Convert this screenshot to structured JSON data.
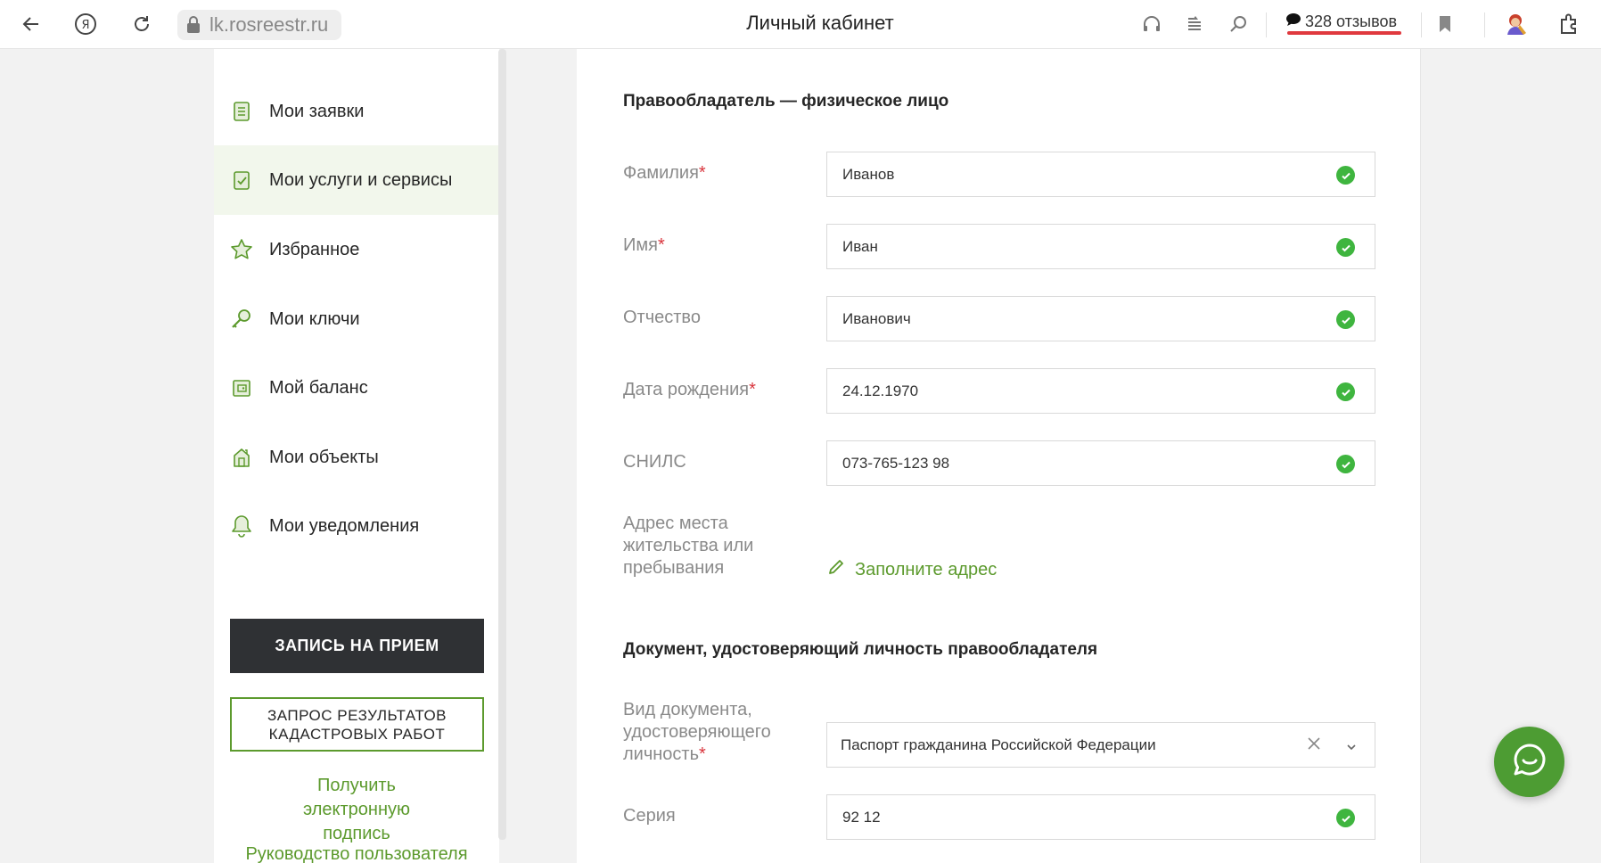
{
  "browser": {
    "url": "lk.rosreestr.ru",
    "tab_title": "Личный кабинет",
    "reviews": "328 отзывов"
  },
  "sidebar": {
    "items": [
      {
        "label": "Мои заявки",
        "icon": "document-icon",
        "active": false
      },
      {
        "label": "Мои услуги и сервисы",
        "icon": "checkbox-icon",
        "active": true
      },
      {
        "label": "Избранное",
        "icon": "star-icon",
        "active": false
      },
      {
        "label": "Мои ключи",
        "icon": "key-icon",
        "active": false
      },
      {
        "label": "Мой баланс",
        "icon": "wallet-icon",
        "active": false
      },
      {
        "label": "Мои объекты",
        "icon": "house-icon",
        "active": false
      },
      {
        "label": "Мои уведомления",
        "icon": "bell-icon",
        "active": false
      }
    ],
    "appointment_button": "ЗАПИСЬ НА ПРИЕМ",
    "cadastral_button": "ЗАПРОС РЕЗУЛЬТАТОВ КАДАСТРОВЫХ РАБОТ",
    "signature_link": "Получить электронную подпись",
    "manual_link": "Руководство пользователя"
  },
  "form": {
    "owner_section_title": "Правообладатель — физическое лицо",
    "fields": {
      "surname": {
        "label": "Фамилия",
        "value": "Иванов",
        "required": true
      },
      "name": {
        "label": "Имя",
        "value": "Иван",
        "required": true
      },
      "patronymic": {
        "label": "Отчество",
        "value": "Иванович",
        "required": false
      },
      "birthdate": {
        "label": "Дата рождения",
        "value": "24.12.1970",
        "required": true
      },
      "snils": {
        "label": "СНИЛС",
        "value": "073-765-123 98",
        "required": false
      }
    },
    "address": {
      "label": "Адрес места жительства или пребывания",
      "link": "Заполните адрес"
    },
    "document_section_title": "Документ, удостоверяющий личность правообладателя",
    "doc_type": {
      "label": "Вид документа, удостоверяющего личность",
      "required": true,
      "value": "Паспорт гражданина Российской Федерации"
    },
    "series": {
      "label": "Серия",
      "value": "92 12"
    },
    "required_mark": "*"
  },
  "colors": {
    "accent_green": "#5c9a2d",
    "check_green": "#3fb53f",
    "required_red": "#d9363e",
    "dark_button": "#2f3134"
  }
}
